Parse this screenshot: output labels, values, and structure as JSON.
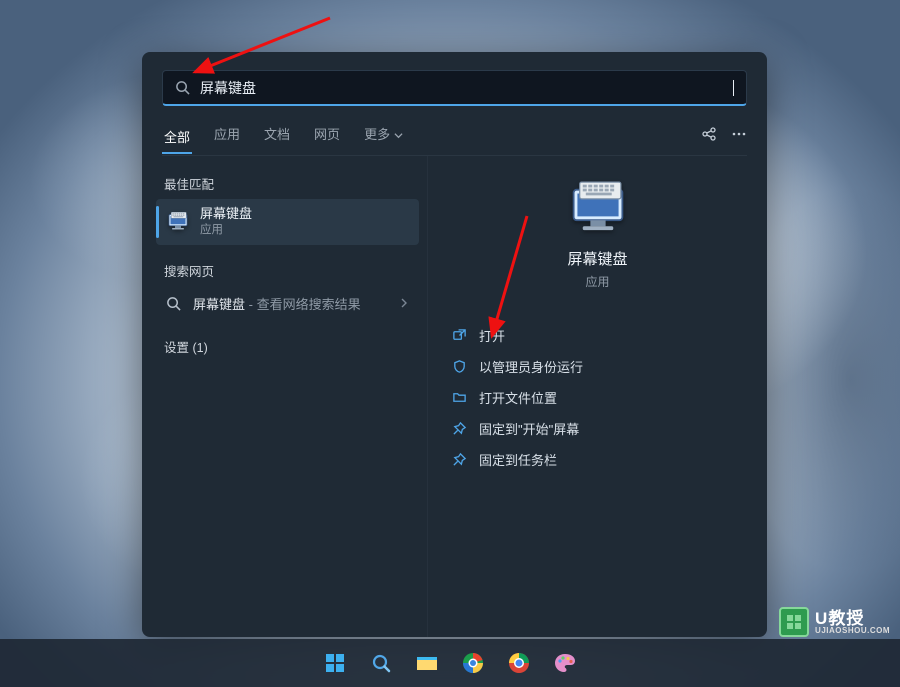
{
  "search": {
    "value": "屏幕键盘"
  },
  "tabs": {
    "items": [
      "全部",
      "应用",
      "文档",
      "网页",
      "更多"
    ],
    "active": 0
  },
  "left": {
    "best_match_label": "最佳匹配",
    "top_result": {
      "title": "屏幕键盘",
      "sub": "应用"
    },
    "web_label": "搜索网页",
    "web_row": {
      "term": "屏幕键盘",
      "suffix": " - 查看网络搜索结果"
    },
    "settings_label": "设置 (1)"
  },
  "preview": {
    "title": "屏幕键盘",
    "sub": "应用"
  },
  "actions": [
    {
      "icon": "open",
      "label": "打开"
    },
    {
      "icon": "admin",
      "label": "以管理员身份运行"
    },
    {
      "icon": "folder",
      "label": "打开文件位置"
    },
    {
      "icon": "pin",
      "label": "固定到\"开始\"屏幕"
    },
    {
      "icon": "pin",
      "label": "固定到任务栏"
    }
  ],
  "watermark": {
    "main": "U教授",
    "sub": "UJIAOSHOU.COM"
  },
  "colors": {
    "accent": "#4ea5e8",
    "panel": "#1f2a35"
  }
}
